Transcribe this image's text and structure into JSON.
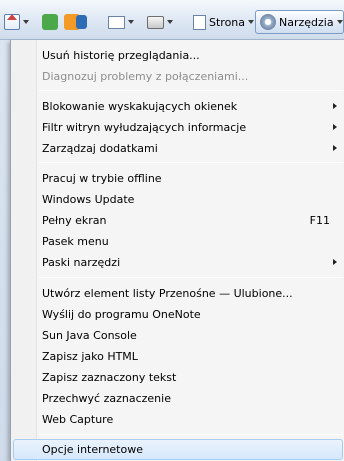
{
  "toolbar": {
    "page_label": "Strona",
    "tools_label": "Narzędzia"
  },
  "menu": {
    "items": [
      {
        "label": "Usuń historię przeglądania..."
      },
      {
        "label": "Diagnozuj problemy z połączeniami..."
      },
      {
        "label": "Blokowanie wyskakujących okienek"
      },
      {
        "label": "Filtr witryn wyłudzających informacje"
      },
      {
        "label": "Zarządzaj dodatkami"
      },
      {
        "label": "Pracuj w trybie offline"
      },
      {
        "label": "Windows Update"
      },
      {
        "label": "Pełny ekran",
        "shortcut": "F11"
      },
      {
        "label": "Pasek menu"
      },
      {
        "label": "Paski narzędzi"
      },
      {
        "label": "Utwórz element listy Przenośne — Ulubione..."
      },
      {
        "label": "Wyślij do programu OneNote"
      },
      {
        "label": "Sun Java Console"
      },
      {
        "label": "Zapisz jako HTML"
      },
      {
        "label": "Zapisz zaznaczony tekst"
      },
      {
        "label": "Przechwyć zaznaczenie"
      },
      {
        "label": "Web Capture"
      },
      {
        "label": "Opcje internetowe"
      }
    ]
  }
}
